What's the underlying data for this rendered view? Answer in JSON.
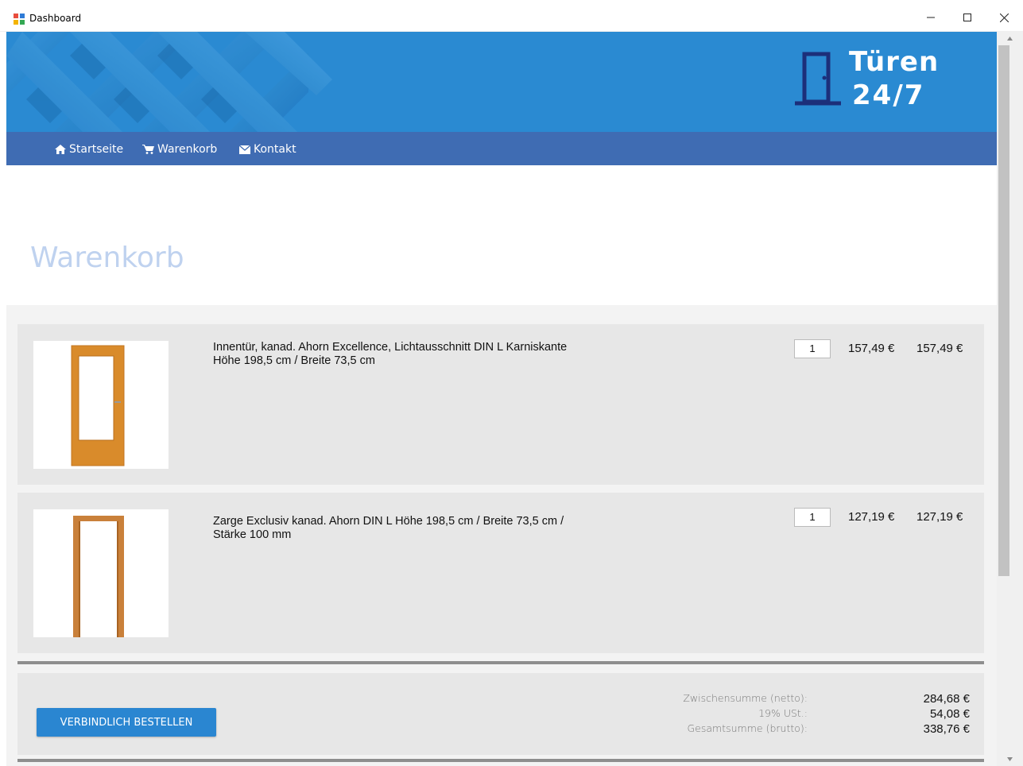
{
  "window": {
    "title": "Dashboard",
    "icons": [
      "app-icon",
      "minimize-icon",
      "maximize-icon",
      "close-icon"
    ]
  },
  "brand": {
    "line1": "Türen",
    "line2": "24/7",
    "logo_icon": "door-icon",
    "banner_color": "#2a8ad2"
  },
  "nav": {
    "color": "#3f6cb3",
    "items": [
      {
        "label": "Startseite",
        "icon": "home-icon"
      },
      {
        "label": "Warenkorb",
        "icon": "cart-icon"
      },
      {
        "label": "Kontakt",
        "icon": "envelope-icon"
      }
    ]
  },
  "page": {
    "title": "Warenkorb"
  },
  "cart": {
    "items": [
      {
        "description": "Innentür, kanad. Ahorn Excellence, Lichtausschnitt DIN L Karniskante Höhe 198,5 cm / Breite 73,5 cm",
        "quantity": "1",
        "unit_price": "157,49 €",
        "total": "157,49 €",
        "image": "door-image"
      },
      {
        "description": "Zarge Exclusiv kanad. Ahorn DIN L Höhe 198,5 cm / Breite 73,5 cm / Stärke 100 mm",
        "quantity": "1",
        "unit_price": "127,19 €",
        "total": "127,19 €",
        "image": "door-frame-image"
      }
    ]
  },
  "summary": {
    "order_button": "VERBINDLICH BESTELLEN",
    "subtotal_label": "Zwischensumme (netto):",
    "subtotal_value": "284,68 €",
    "vat_label": "19% USt.:",
    "vat_value": "54,08 €",
    "total_label": "Gesamtsumme (brutto):",
    "total_value": "338,76 €",
    "button_color": "#2a86d1"
  }
}
